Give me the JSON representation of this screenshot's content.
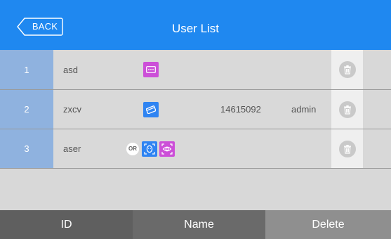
{
  "header": {
    "back_label": "BACK",
    "title": "User List"
  },
  "users": [
    {
      "id": "1",
      "name": "asd",
      "credentials": [
        "password-icon"
      ],
      "card_number": "",
      "role": ""
    },
    {
      "id": "2",
      "name": "zxcv",
      "credentials": [
        "card-icon"
      ],
      "card_number": "14615092",
      "role": "admin"
    },
    {
      "id": "3",
      "name": "aser",
      "or_label": "OR",
      "credentials": [
        "face-icon",
        "eye-icon"
      ],
      "card_number": "",
      "role": ""
    }
  ],
  "footer": {
    "id_label": "ID",
    "name_label": "Name",
    "delete_label": "Delete"
  },
  "colors": {
    "header": "#1f88f0",
    "id_cell": "#8fb2df",
    "credential_purple": "#cc4fd8",
    "credential_blue": "#2f84f2"
  }
}
